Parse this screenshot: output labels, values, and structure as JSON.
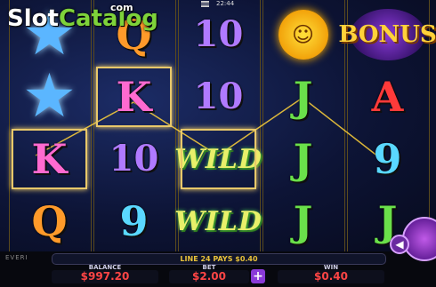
{
  "logo": {
    "slot": "Slot",
    "catalog": "Catalog",
    "com": "com"
  },
  "header": {
    "clock": "22:44"
  },
  "reels": [
    {
      "symbols": [
        {
          "type": "star",
          "icon": "blue-star-icon",
          "color": "#5bb6ff"
        },
        {
          "type": "star",
          "icon": "blue-star-icon",
          "color": "#5bb6ff"
        },
        {
          "type": "letter",
          "text": "K",
          "color": "#ff6ad0",
          "framed": true
        },
        {
          "type": "letter",
          "text": "Q",
          "color": "#ff9a2a"
        }
      ]
    },
    {
      "symbols": [
        {
          "type": "letter",
          "text": "Q",
          "color": "#ff9a2a"
        },
        {
          "type": "letter",
          "text": "K",
          "color": "#ff6ad0",
          "framed": true
        },
        {
          "type": "letter",
          "text": "10",
          "color": "#b07aff"
        },
        {
          "type": "letter",
          "text": "9",
          "color": "#5ad8ff"
        }
      ]
    },
    {
      "symbols": [
        {
          "type": "letter",
          "text": "10",
          "color": "#b07aff"
        },
        {
          "type": "letter",
          "text": "10",
          "color": "#b07aff"
        },
        {
          "type": "wild",
          "text": "WILD",
          "framed": true
        },
        {
          "type": "wild",
          "text": "WILD"
        }
      ]
    },
    {
      "symbols": [
        {
          "type": "sun",
          "icon": "sun-face-icon"
        },
        {
          "type": "letter",
          "text": "J",
          "color": "#6ae04a"
        },
        {
          "type": "letter",
          "text": "J",
          "color": "#6ae04a"
        },
        {
          "type": "letter",
          "text": "J",
          "color": "#6ae04a"
        }
      ]
    },
    {
      "symbols": [
        {
          "type": "bonus",
          "text": "BONUS"
        },
        {
          "type": "letter",
          "text": "A",
          "color": "#ff3a3a"
        },
        {
          "type": "letter",
          "text": "9",
          "color": "#5ad8ff"
        },
        {
          "type": "letter",
          "text": "J",
          "color": "#6ae04a"
        }
      ]
    }
  ],
  "win_message": "LINE 24 PAYS $0.40",
  "brand": "EVERI",
  "balance": {
    "label": "BALANCE",
    "value": "$997.20"
  },
  "bet": {
    "label": "BET",
    "value": "$2.00",
    "plus": "+"
  },
  "win": {
    "label": "WIN",
    "value": "$0.40"
  },
  "colors": {
    "accent": "#8a3ad8",
    "value_red": "#ff4545",
    "frame_gold": "#e8c86a"
  }
}
